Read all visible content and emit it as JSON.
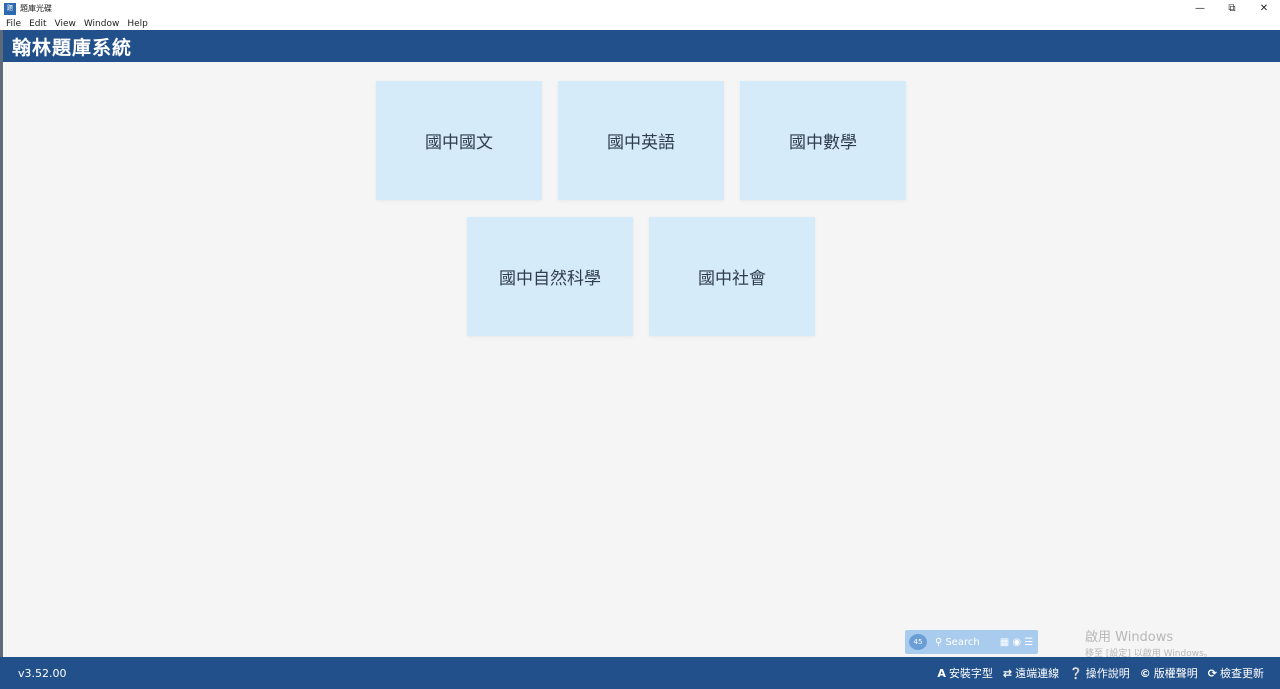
{
  "window": {
    "title": "題庫光碟",
    "icon": "app-icon",
    "controls": [
      "minimize-icon",
      "restore-icon",
      "close-icon"
    ]
  },
  "menu": {
    "items": [
      {
        "label": "File"
      },
      {
        "label": "Edit"
      },
      {
        "label": "View"
      },
      {
        "label": "Window"
      },
      {
        "label": "Help"
      }
    ]
  },
  "header": {
    "title": "翰林題庫系統"
  },
  "subjects": [
    {
      "label": "國中國文"
    },
    {
      "label": "國中英語"
    },
    {
      "label": "國中數學"
    },
    {
      "label": "國中自然科學"
    },
    {
      "label": "國中社會"
    }
  ],
  "taskbar_widget": {
    "badge": "45",
    "search": "Search"
  },
  "activation": {
    "title": "啟用 Windows",
    "subtitle": "移至 [設定] 以啟用 Windows。"
  },
  "footer": {
    "version": "v3.52.00",
    "links": [
      {
        "label": "安裝字型",
        "icon": "font-icon"
      },
      {
        "label": "遠端連線",
        "icon": "swap-arrows-icon"
      },
      {
        "label": "操作說明",
        "icon": "question-icon"
      },
      {
        "label": "版權聲明",
        "icon": "copyright-icon"
      },
      {
        "label": "檢查更新",
        "icon": "refresh-icon"
      }
    ]
  },
  "colors": {
    "brand": "#22508a",
    "card": "#d6ebfa",
    "background": "#f5f5f5"
  }
}
